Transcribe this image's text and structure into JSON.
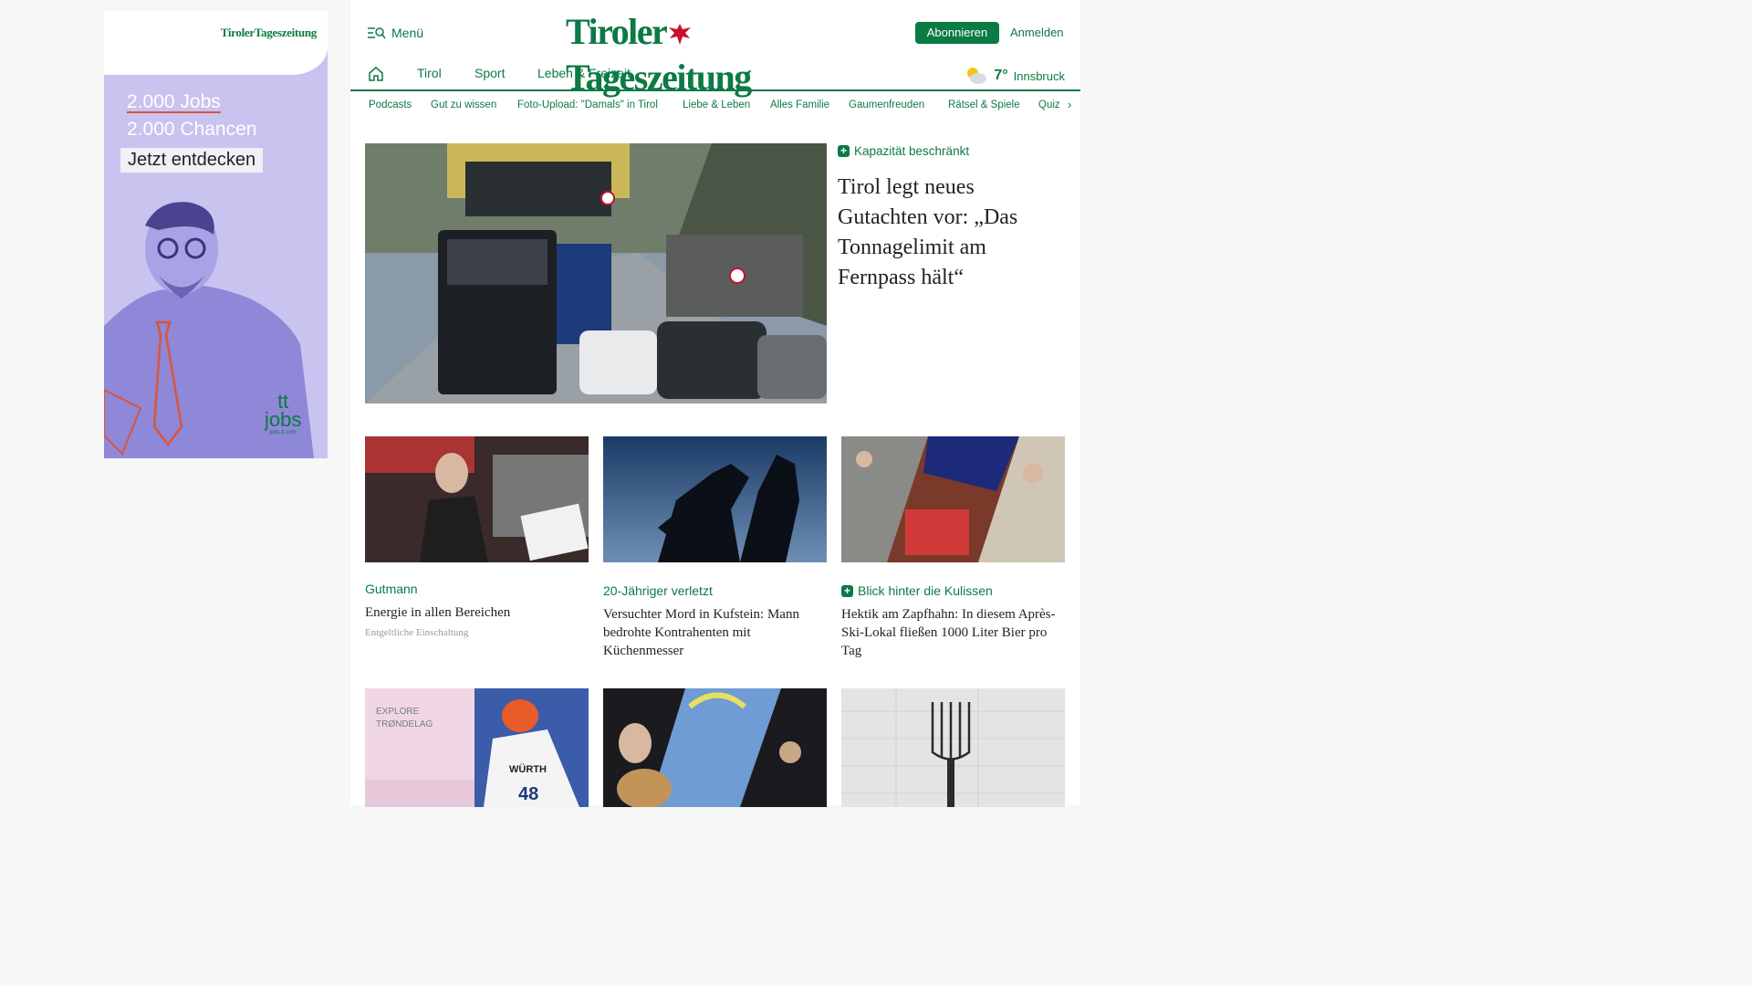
{
  "ad": {
    "logo": "TirolerTageszeitung",
    "line1": "2.000 Jobs",
    "line2": "2.000 Chancen",
    "cta": "Jetzt entdecken",
    "brand": "tt",
    "brand2": "jobs",
    "url": "jobs.tt.com"
  },
  "header": {
    "menu_label": "Menü",
    "logo_left": "Tiroler",
    "logo_right": "Tageszeitung",
    "subscribe_label": "Abonnieren",
    "login_label": "Anmelden"
  },
  "nav": {
    "items": [
      "Tirol",
      "Sport",
      "Leben & Freizeit"
    ],
    "weather_temp": "7°",
    "weather_city": "Innsbruck"
  },
  "subnav": {
    "items": [
      "Podcasts",
      "Gut zu wissen",
      "Foto-Upload: \"Damals\" in Tirol",
      "Liebe & Leben",
      "Alles Familie",
      "Gaumenfreuden",
      "Rätsel & Spiele",
      "Quiz"
    ]
  },
  "hero": {
    "kicker": "Kapazität beschränkt",
    "title": "Tirol legt neues Gutachten vor: „Das Tonnagelimit am Fernpass hält“"
  },
  "cards": [
    {
      "kicker": "Gutmann",
      "title": "Energie in allen Bereichen",
      "sub": "Entgeltliche Einschaltung"
    },
    {
      "kicker": "20-Jähriger verletzt",
      "title": "Versuchter Mord in Kufstein: Mann bedrohte Kontrahenten mit Küchenmesser"
    },
    {
      "kicker": "Blick hinter die Kulissen",
      "title": "Hektik am Zapfhahn: In diesem Après-Ski-Lokal fließen 1000 Liter Bier pro Tag"
    }
  ],
  "bottom_imgs": {
    "ski_text1": "EXPLORE",
    "ski_text2": "TRØNDELAG",
    "ski_sponsor": "WÜRTH",
    "ski_bib": "48"
  }
}
